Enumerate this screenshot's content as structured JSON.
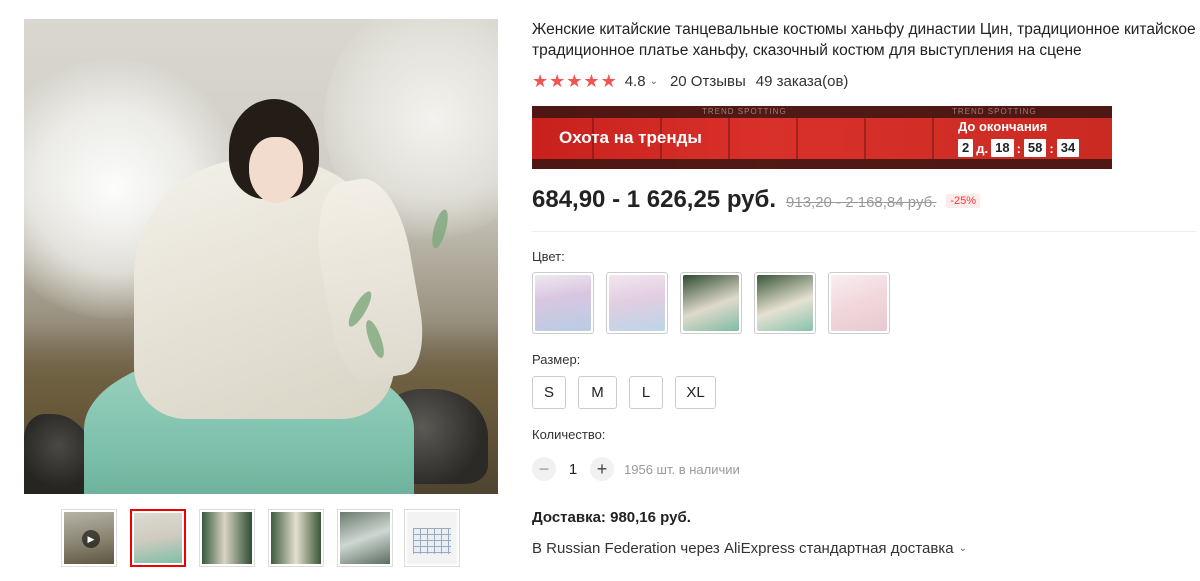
{
  "product": {
    "title": "Женские китайские танцевальные костюмы ханьфу династии Цин, традиционное китайское традиционное платье ханьфу, сказочный костюм для выступления на сцене",
    "rating": "4.8",
    "reviews": "20 Отзывы",
    "orders": "49 заказа(ов)",
    "stars": 5,
    "star_color": "#f25450"
  },
  "promo": {
    "label": "Охота на тренды",
    "brand_strip": "TREND SPOTTING",
    "until_label": "До окончания",
    "days": "2",
    "days_unit": "д.",
    "hours": "18",
    "minutes": "58",
    "seconds": "34",
    "bg_color": "#d9312a"
  },
  "pricing": {
    "price": "684,90 - 1 626,25 руб.",
    "old_price": "913,20 - 2 168,84 руб.",
    "discount": "-25%"
  },
  "options": {
    "color_label": "Цвет:",
    "size_label": "Размер:",
    "sizes": [
      "S",
      "M",
      "L",
      "XL"
    ],
    "quantity_label": "Количество:",
    "quantity": "1",
    "minus": "−",
    "plus": "+",
    "stock": "1956 шт. в наличии"
  },
  "shipping": {
    "price": "Доставка: 980,16 руб.",
    "method": "В Russian Federation через AliExpress стандартная доставка"
  },
  "gallery": {
    "active_thumb": 2,
    "play_icon": "▶"
  }
}
